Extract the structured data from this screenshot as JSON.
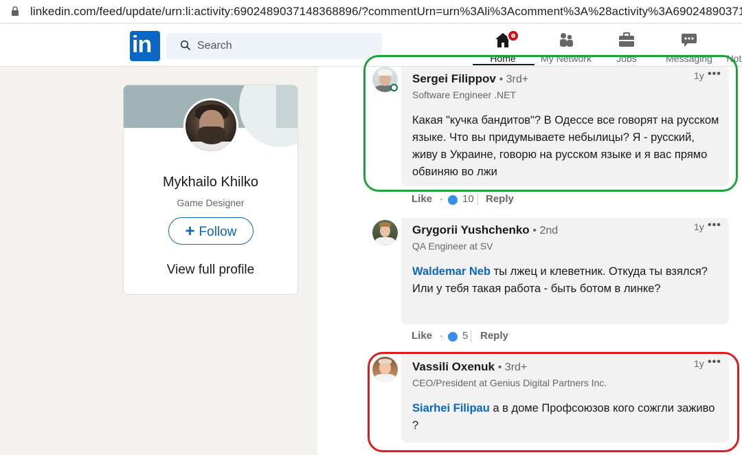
{
  "browser": {
    "url": "linkedin.com/feed/update/urn:li:activity:6902489037148368896/?commentUrn=urn%3Ali%3Acomment%3A%28activity%3A69024890371"
  },
  "nav": {
    "logo_text": "in",
    "search_placeholder": "Search",
    "items": [
      {
        "label": "Home",
        "icon": "home-icon"
      },
      {
        "label": "My Network",
        "icon": "network-icon"
      },
      {
        "label": "Jobs",
        "icon": "briefcase-icon"
      },
      {
        "label": "Messaging",
        "icon": "messaging-icon"
      },
      {
        "label": "Noti",
        "icon": "bell-icon"
      }
    ]
  },
  "profile_card": {
    "name": "Mykhailo Khilko",
    "title": "Game Designer",
    "follow_label": "Follow",
    "link_label": "View full profile"
  },
  "comments": [
    {
      "name": "Sergei Filippov",
      "degree": "• 3rd+",
      "headline": "Software Engineer .NET",
      "time": "1y",
      "more": "•••",
      "mention": "",
      "text": "Какая \"кучка бандитов\"? В Одессе все говорят на русском языке. Что вы придумываете небылицы? Я - русский, живу в Украине, говорю на русском языке и я вас прямо обвиняю во лжи",
      "like_label": "Like",
      "reaction_count": "10",
      "reply_label": "Reply"
    },
    {
      "name": "Grygorii Yushchenko",
      "degree": "• 2nd",
      "headline": "QA Engineer at SV",
      "time": "1y",
      "more": "•••",
      "mention": "Waldemar Neb",
      "text": " ты лжец и клеветник. Откуда ты взялся? Или у тебя такая работа - быть ботом в линке?",
      "like_label": "Like",
      "reaction_count": "5",
      "reply_label": "Reply"
    },
    {
      "name": "Vassili Oxenuk",
      "degree": "• 3rd+",
      "headline": "CEO/President at Genius Digital Partners Inc.",
      "time": "1y",
      "more": "•••",
      "mention": "Siarhei Filipau",
      "text": " а в доме Профсоюзов кого сожгли заживо ?",
      "like_label": "Like",
      "reaction_count": "",
      "reply_label": "Reply"
    }
  ],
  "colors": {
    "brand": "#0a66c2",
    "highlight_green": "#1ba33a",
    "highlight_red": "#e01b1b"
  }
}
